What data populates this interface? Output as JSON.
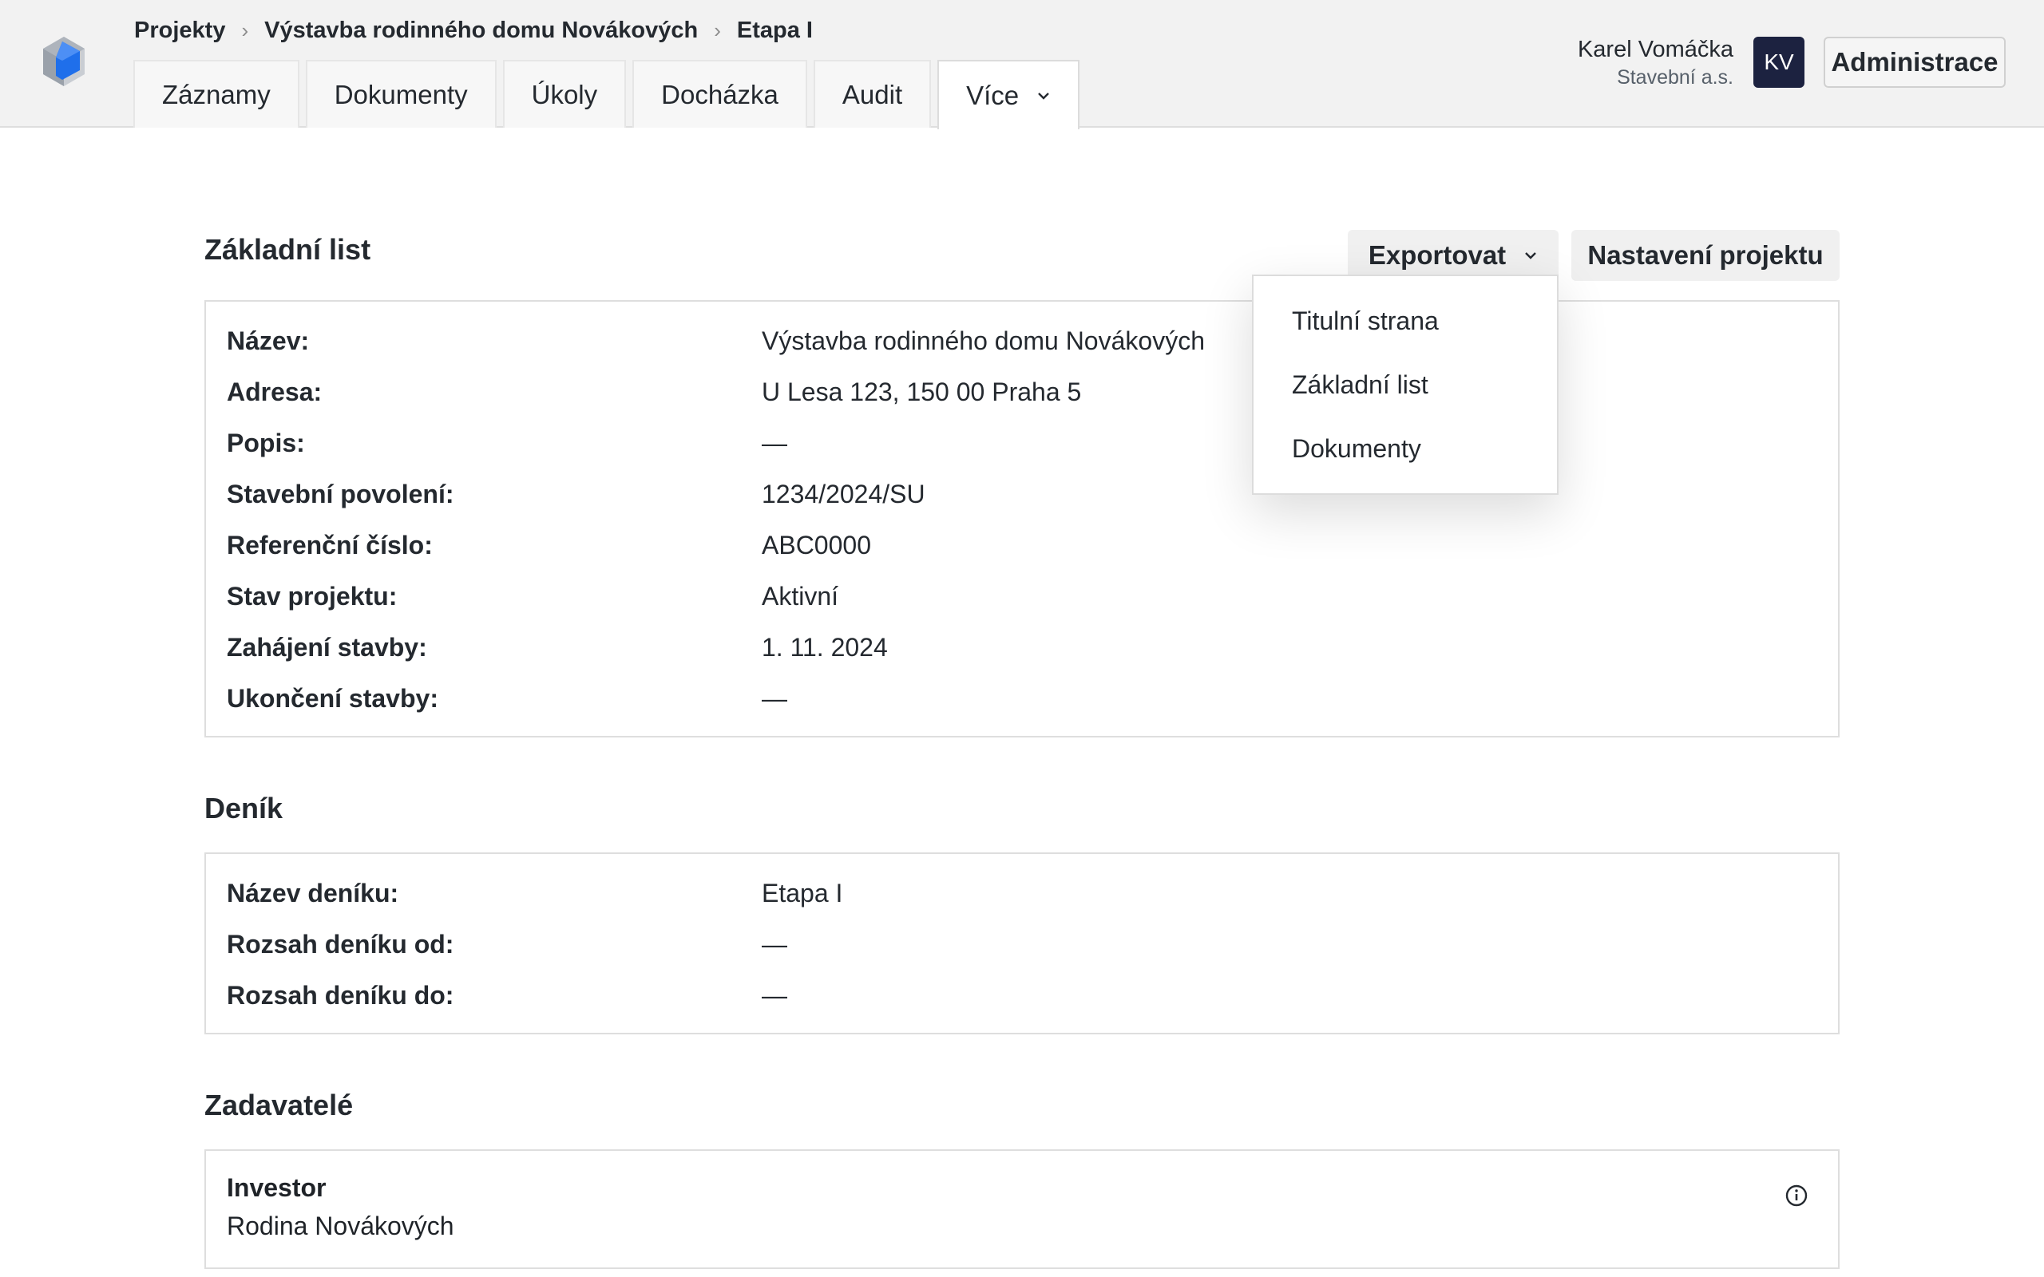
{
  "breadcrumb": [
    "Projekty",
    "Výstavba rodinného domu Novákových",
    "Etapa I"
  ],
  "tabs": [
    {
      "label": "Záznamy"
    },
    {
      "label": "Dokumenty"
    },
    {
      "label": "Úkoly"
    },
    {
      "label": "Docházka"
    },
    {
      "label": "Audit"
    },
    {
      "label": "Více",
      "active": true
    }
  ],
  "user": {
    "name": "Karel Vomáčka",
    "company": "Stavební a.s.",
    "initials": "KV"
  },
  "admin_label": "Administrace",
  "basic": {
    "title": "Základní list",
    "export_label": "Exportovat",
    "settings_label": "Nastavení projektu",
    "export_menu": [
      "Titulní strana",
      "Základní list",
      "Dokumenty"
    ],
    "rows": [
      {
        "label": "Název:",
        "value": "Výstavba rodinného domu Novákových"
      },
      {
        "label": "Adresa:",
        "value": "U Lesa 123, 150 00 Praha 5"
      },
      {
        "label": "Popis:",
        "value": "—"
      },
      {
        "label": "Stavební povolení:",
        "value": "1234/2024/SU"
      },
      {
        "label": "Referenční číslo:",
        "value": "ABC0000"
      },
      {
        "label": "Stav projektu:",
        "value": "Aktivní"
      },
      {
        "label": "Zahájení stavby:",
        "value": "1. 11. 2024"
      },
      {
        "label": "Ukončení stavby:",
        "value": "—"
      }
    ]
  },
  "diary": {
    "title": "Deník",
    "rows": [
      {
        "label": "Název deníku:",
        "value": "Etapa I"
      },
      {
        "label": "Rozsah deníku od:",
        "value": "—"
      },
      {
        "label": "Rozsah deníku do:",
        "value": "—"
      }
    ]
  },
  "clients": {
    "title": "Zadavatelé",
    "role": "Investor",
    "name": "Rodina Novákových"
  },
  "colors": {
    "avatar_bg": "#1c2240",
    "logo_blue": "#1f6feb",
    "header_bg": "#f2f2f2"
  },
  "icons": [
    "app-logo-icon",
    "chevron-right-icon",
    "chevron-down-icon",
    "info-icon"
  ]
}
